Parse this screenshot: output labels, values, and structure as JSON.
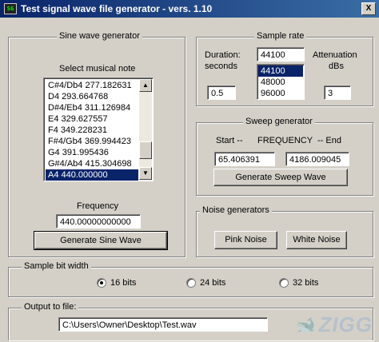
{
  "window": {
    "title": "Test signal wave file generator - vers. 1.10",
    "close_label": "X",
    "icon_label": "SG"
  },
  "sine": {
    "group_title": "Sine wave generator",
    "select_label": "Select musical note",
    "notes": [
      "C#4/Db4 277.182631",
      "D4 293.664768",
      "D#4/Eb4 311.126984",
      "E4 329.627557",
      "F4 349.228231",
      "F#4/Gb4 369.994423",
      "G4 391.995436",
      "G#4/Ab4 415.304698",
      "A4 440.000000"
    ],
    "selected_note_index": 8,
    "frequency_label": "Frequency",
    "frequency_value": "440.00000000000",
    "generate_label": "Generate Sine Wave"
  },
  "sample_rate": {
    "group_title": "Sample rate",
    "duration_label_1": "Duration:",
    "duration_label_2": "seconds",
    "duration_value": "0.5",
    "rate_value": "44100",
    "rate_options": [
      "44100",
      "48000",
      "96000"
    ],
    "selected_rate_index": 0,
    "attenuation_label_1": "Attenuation",
    "attenuation_label_2": "dBs",
    "attenuation_value": "3"
  },
  "sweep": {
    "group_title": "Sweep generator",
    "start_label": "Start --",
    "frequency_label": "FREQUENCY",
    "end_label": "-- End",
    "start_value": "65.406391",
    "end_value": "4186.009045",
    "generate_label": "Generate Sweep Wave"
  },
  "noise": {
    "group_title": "Noise generators",
    "pink_label": "Pink Noise",
    "white_label": "White Noise"
  },
  "bit_width": {
    "group_title": "Sample bit width",
    "options": [
      "16 bits",
      "24 bits",
      "32 bits"
    ],
    "selected_index": 0
  },
  "output": {
    "group_title": "Output to file:",
    "path": "C:\\Users\\Owner\\Desktop\\Test.wav"
  },
  "watermark": {
    "text": "ZIGG"
  }
}
